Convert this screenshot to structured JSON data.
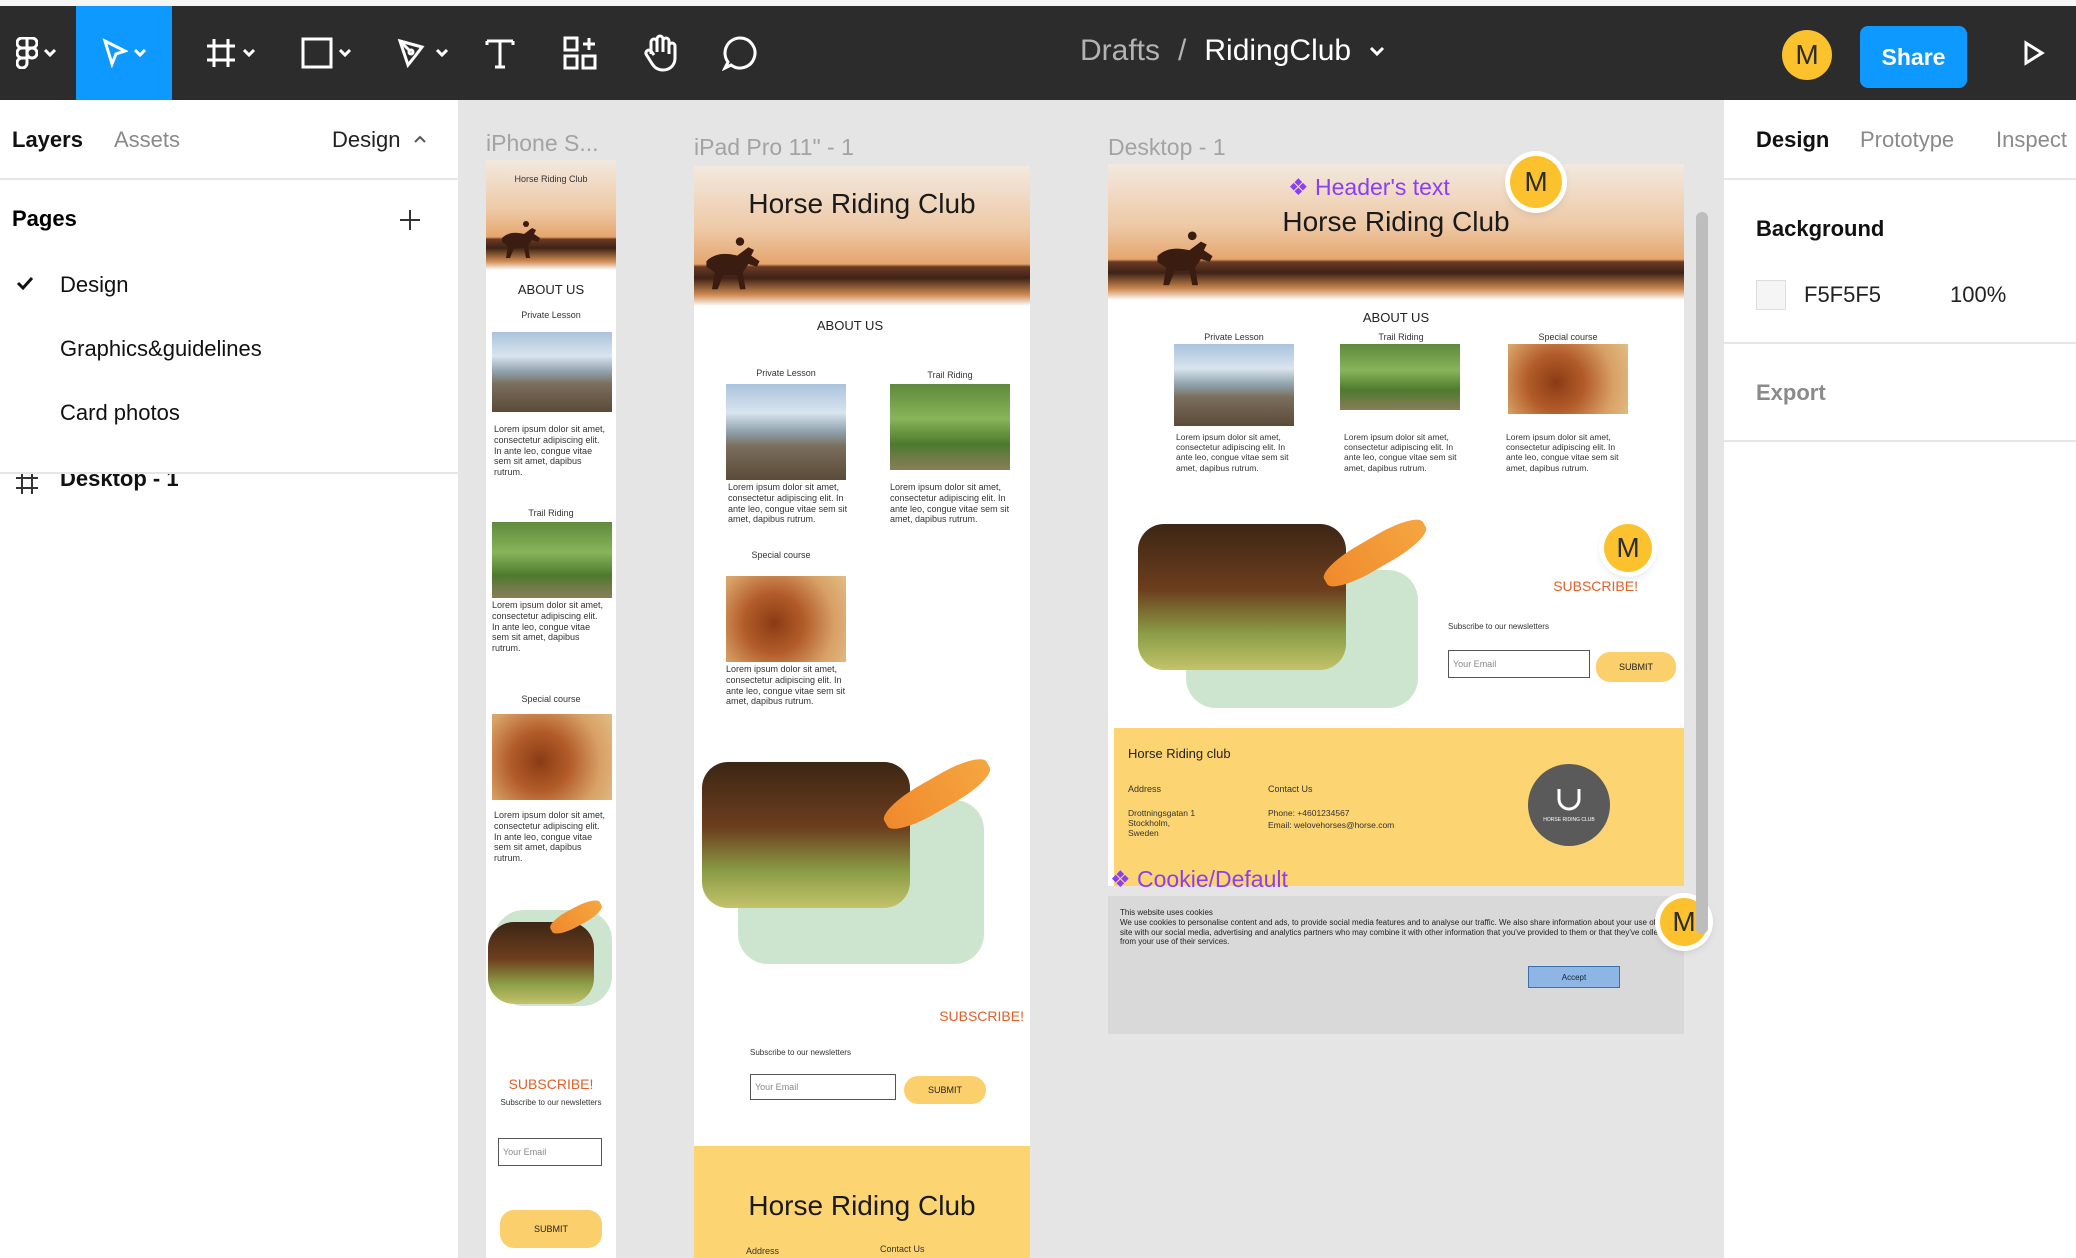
{
  "toolbar": {
    "breadcrumb_root": "Drafts",
    "separator": "/",
    "file_name": "RidingClub",
    "user_initial": "M",
    "share_label": "Share"
  },
  "left": {
    "tab_layers": "Layers",
    "tab_assets": "Assets",
    "page_switch": "Design",
    "pages_heading": "Pages",
    "pages": [
      "Design",
      "Graphics&guidelines",
      "Card photos"
    ],
    "layer_item": "Desktop - 1"
  },
  "right": {
    "tabs": [
      "Design",
      "Prototype",
      "Inspect"
    ],
    "background_heading": "Background",
    "bg_hex": "F5F5F5",
    "bg_opacity": "100%",
    "export_heading": "Export"
  },
  "frames": {
    "iphone_label": "iPhone S...",
    "ipad_label": "iPad Pro 11\" - 1",
    "desktop_label": "Desktop - 1"
  },
  "site": {
    "title": "Horse Riding Club",
    "about": "ABOUT US",
    "private": "Private Lesson",
    "trail": "Trail  Riding",
    "special": "Special course",
    "lorem_long": "Lorem ipsum dolor sit amet, consectetur adipiscing elit. In ante leo, congue vitae sem sit amet, dapibus rutrum.",
    "subscribe": "SUBSCRIBE!",
    "newsletter": "Subscribe to our newsletters",
    "email_ph": "Your Email",
    "submit": "SUBMIT",
    "footer_title": "Horse Riding club",
    "address_h": "Address",
    "address": "Drottningsgatan 1\nStockholm,\nSweden",
    "contact_h": "Contact Us",
    "phone": "Phone: +4601234567",
    "mail": "Email: welovehorses@horse.com",
    "logo_text": "HORSE RIDING CLUB",
    "footer_title_ipad": "Horse Riding Club"
  },
  "components": {
    "header_text": "Header's text",
    "cookie": "Cookie/Default"
  },
  "cookie": {
    "title": "This website uses cookies",
    "body": "We use cookies to personalise content and ads, to provide social media features and to analyse our traffic. We also share information about your use of our site with our social media, advertising and analytics partners who may combine it with other information that you've provided to them or that they've collected from your use of their services.",
    "accept": "Accept"
  },
  "colors": {
    "accent": "#0d99ff",
    "avatar": "#fcc22d",
    "component": "#8b3ff5",
    "subscribe": "#e0602a",
    "footer": "#fcd472"
  }
}
